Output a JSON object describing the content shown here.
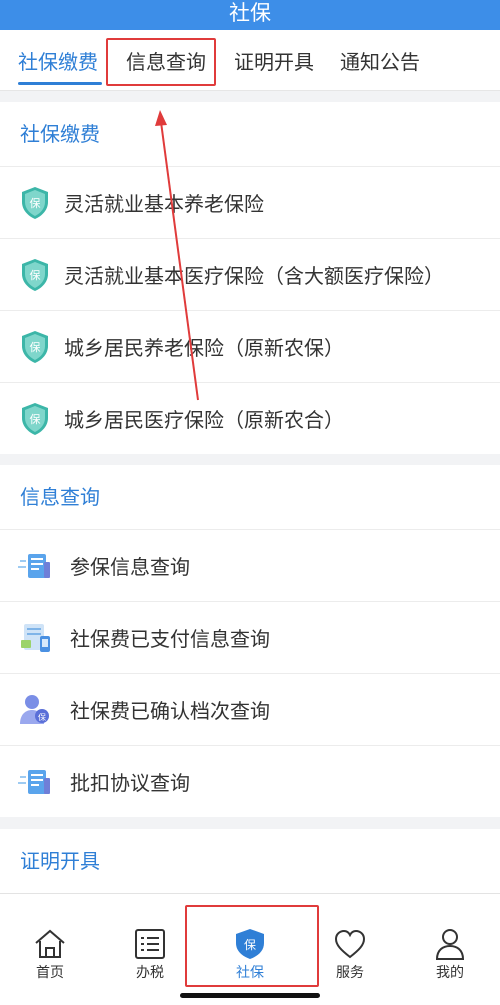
{
  "app": {
    "title": "社保"
  },
  "tabs": [
    {
      "label": "社保缴费",
      "active": true
    },
    {
      "label": "信息查询",
      "active": false
    },
    {
      "label": "证明开具",
      "active": false
    },
    {
      "label": "通知公告",
      "active": false
    }
  ],
  "sections": [
    {
      "title": "社保缴费",
      "items": [
        {
          "label": "灵活就业基本养老保险",
          "icon": "shield-bao-icon"
        },
        {
          "label": "灵活就业基本医疗保险（含大额医疗保险）",
          "icon": "shield-bao-icon"
        },
        {
          "label": "城乡居民养老保险（原新农保）",
          "icon": "shield-bao-icon"
        },
        {
          "label": "城乡居民医疗保险（原新农合）",
          "icon": "shield-bao-icon"
        }
      ]
    },
    {
      "title": "信息查询",
      "items": [
        {
          "label": "参保信息查询",
          "icon": "document-search-icon"
        },
        {
          "label": "社保费已支付信息查询",
          "icon": "payment-document-icon"
        },
        {
          "label": "社保费已确认档次查询",
          "icon": "user-badge-icon"
        },
        {
          "label": "批扣协议查询",
          "icon": "document-search-icon"
        }
      ]
    },
    {
      "title": "证明开具",
      "items": []
    }
  ],
  "bottom_nav": [
    {
      "label": "首页",
      "icon": "home-icon",
      "active": false
    },
    {
      "label": "办税",
      "icon": "tax-list-icon",
      "active": false
    },
    {
      "label": "社保",
      "icon": "shield-bao-icon",
      "active": true
    },
    {
      "label": "服务",
      "icon": "heart-icon",
      "active": false
    },
    {
      "label": "我的",
      "icon": "user-icon",
      "active": false
    }
  ],
  "colors": {
    "header": "#3d8ee8",
    "accent": "#2f7fd6",
    "annotation": "#e03b3b",
    "shield": "#3cb6a8"
  }
}
